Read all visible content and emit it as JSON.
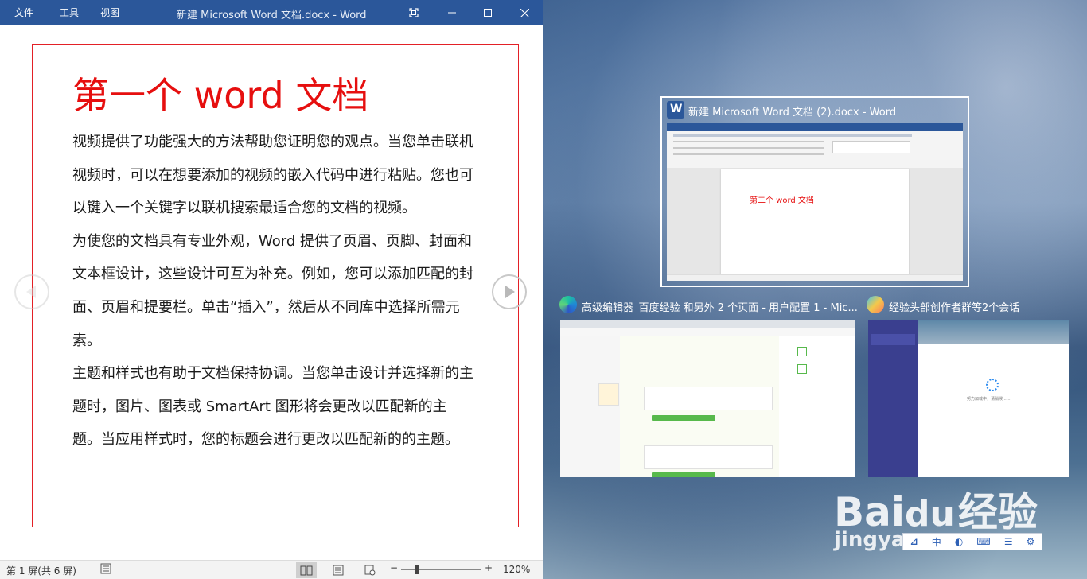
{
  "word_window": {
    "menu": [
      "文件",
      "工具",
      "视图"
    ],
    "title": "新建 Microsoft Word 文档.docx  -  Word",
    "heading": "第一个 word 文档",
    "paragraphs": [
      "视频提供了功能强大的方法帮助您证明您的观点。当您单击联机视频时，可以在想要添加的视频的嵌入代码中进行粘贴。您也可以键入一个关键字以联机搜索最适合您的文档的视频。",
      "为使您的文档具有专业外观，Word 提供了页眉、页脚、封面和文本框设计，这些设计可互为补充。例如，您可以添加匹配的封面、页眉和提要栏。单击“插入”，然后从不同库中选择所需元素。",
      "主题和样式也有助于文档保持协调。当您单击设计并选择新的主题时，图片、图表或 SmartArt 图形将会更改以匹配新的主题。当应用样式时，您的标题会进行更改以匹配新的的主题。"
    ],
    "status": {
      "page_info": "第 1 屏(共 6 屏)",
      "zoom_minus": "−",
      "zoom_plus": "+",
      "zoom": "120%",
      "zoom_level": 0.2
    },
    "accent_color": "#2b579a",
    "heading_color": "#e60f0f"
  },
  "task_view": {
    "word_thumb": {
      "title": "新建 Microsoft Word 文档 (2).docx - Word",
      "doc_text": "第二个 word 文档"
    },
    "edge_thumb": {
      "title": "高级编辑器_百度经验 和另外 2 个页面 - 用户配置 1 - Mic..."
    },
    "chat_thumb": {
      "title": "经验头部创作者群等2个会话",
      "loading_text": "努力加载中，请稍候......"
    }
  },
  "watermark": {
    "brand": "Bai",
    "brand_suffix": "经验",
    "sub": "jingya"
  },
  "ime_toolbar": {
    "items": [
      "中",
      "◐",
      "⌨",
      "☰",
      "⚙"
    ]
  }
}
